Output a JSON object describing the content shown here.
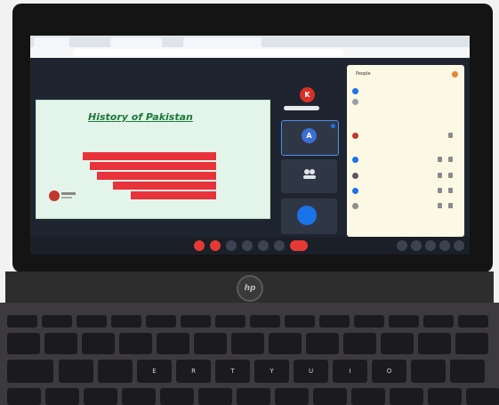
{
  "slide": {
    "title": "History of Pakistan"
  },
  "participants": {
    "speaker_initial": "K",
    "tile_avatar_initial": "A"
  },
  "panel": {
    "title": "People"
  },
  "laptop": {
    "brand": "hp"
  },
  "keyboard": {
    "row_letters": [
      "E",
      "R",
      "T",
      "Y",
      "U",
      "I",
      "O"
    ]
  },
  "colors": {
    "slide_bar": "#e8333b",
    "end_call": "#e53935",
    "meet_blue": "#1a73e8",
    "panel_bg": "#fbf8e4"
  }
}
